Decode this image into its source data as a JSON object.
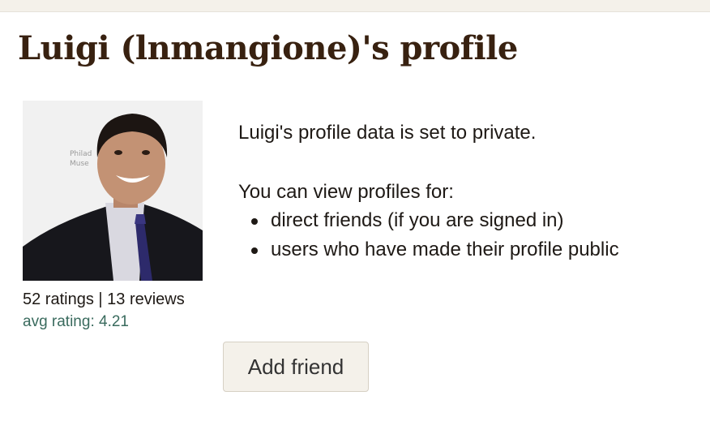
{
  "page": {
    "title": "Luigi (lnmangione)'s profile"
  },
  "profile": {
    "avatar_alt": "profile photo",
    "stats": "52 ratings | 13 reviews",
    "avg_rating": "avg rating: 4.21"
  },
  "privacy": {
    "message": "Luigi's profile data is set to private.",
    "view_intro": "You can view profiles for:",
    "view_options": [
      "direct friends (if you are signed in)",
      "users who have made their profile public"
    ]
  },
  "actions": {
    "add_friend_label": "Add friend"
  },
  "colors": {
    "title": "#382110",
    "avg_rating": "#3a6b5e",
    "button_bg": "#f4f1ea"
  }
}
